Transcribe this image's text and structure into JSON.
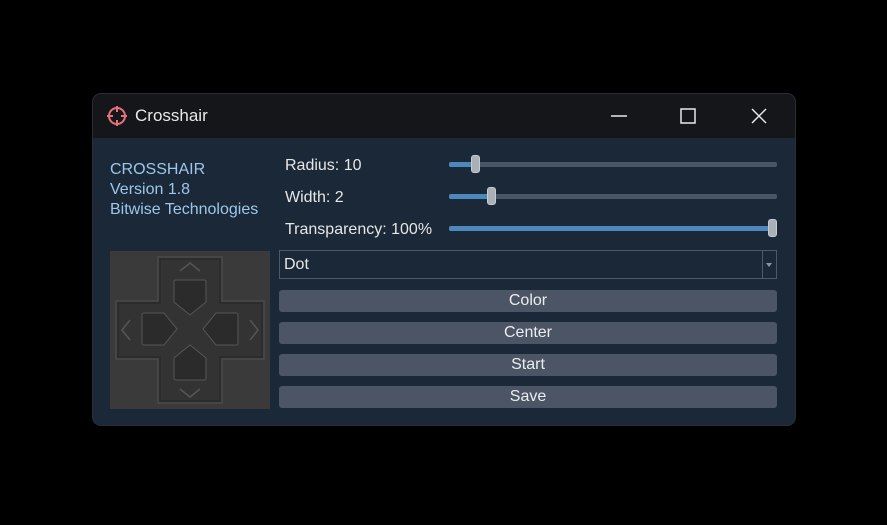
{
  "window": {
    "title": "Crosshair"
  },
  "info": {
    "line1": "CROSSHAIR",
    "line2": "Version 1.8",
    "line3": "Bitwise Technologies"
  },
  "sliders": {
    "radius": {
      "label": "Radius: 10",
      "level": 0.07
    },
    "width": {
      "label": "Width: 2",
      "level": 0.12
    },
    "transparency": {
      "label": "Transparency: 100%",
      "level": 1.0
    }
  },
  "shape_select": {
    "value": "Dot"
  },
  "buttons": {
    "color": "Color",
    "center": "Center",
    "start": "Start",
    "save": "Save"
  },
  "colors": {
    "accent": "#4d88bd",
    "info_text": "#9cc7ea",
    "app_icon": "#e8707a"
  }
}
